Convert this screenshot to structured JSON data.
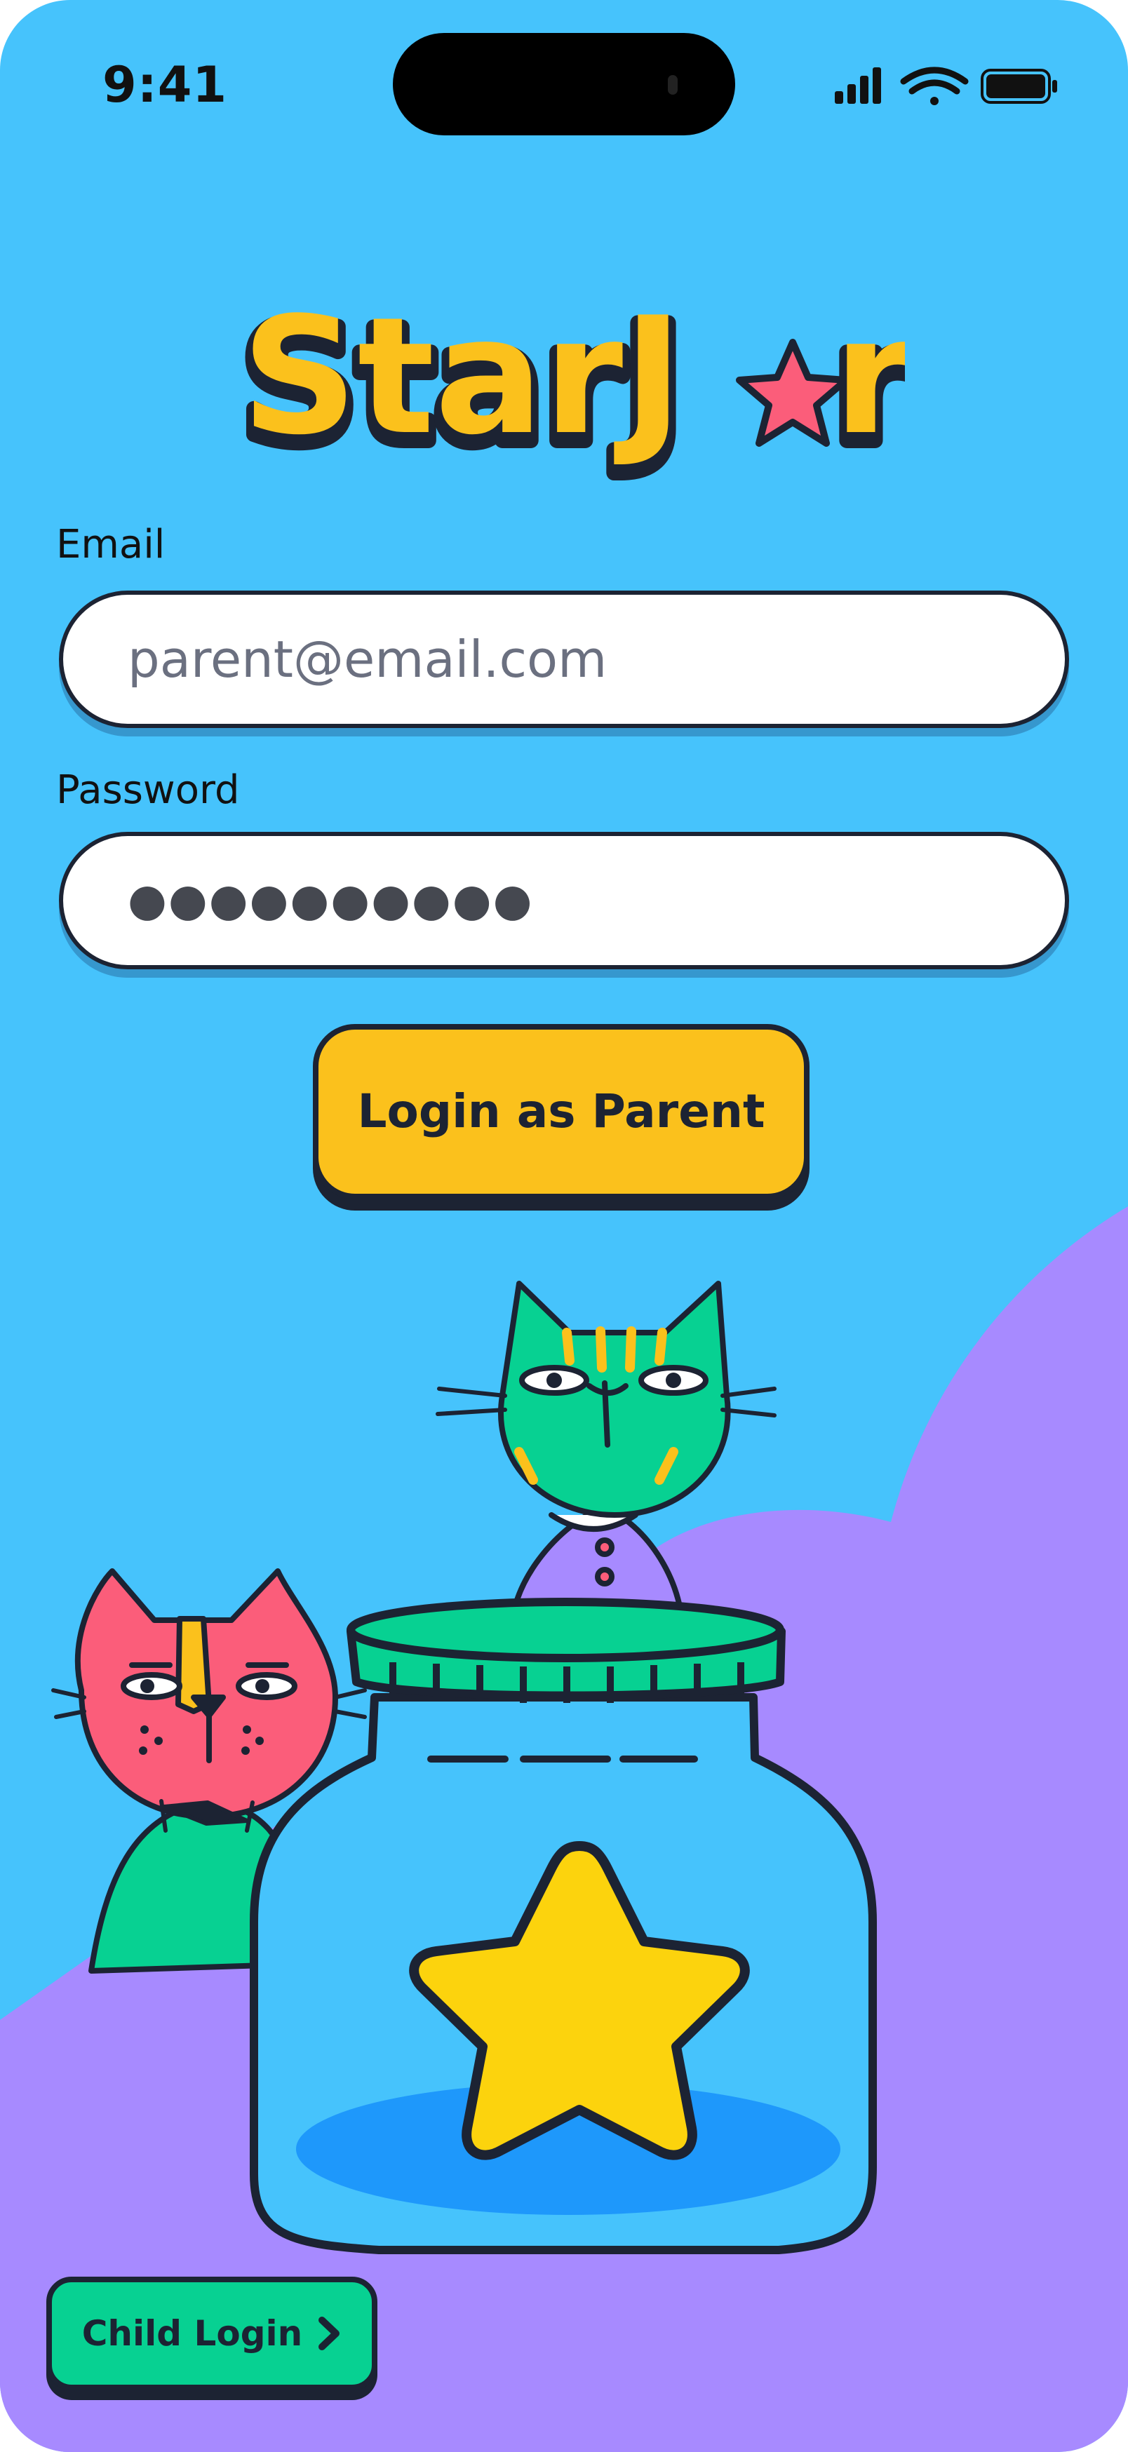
{
  "status_bar": {
    "time": "9:41",
    "signal_icon": "cellular-signal-icon",
    "wifi_icon": "wifi-icon",
    "battery_icon": "battery-icon"
  },
  "logo": {
    "text": "StarJ",
    "text_end": "r",
    "star_icon": "star-icon"
  },
  "form": {
    "email_label": "Email",
    "email_placeholder": "parent@email.com",
    "password_label": "Password",
    "password_value": "●●●●●●●●●●",
    "login_button": "Login as Parent"
  },
  "illustration": {
    "description_icons": [
      "cat-icon",
      "jar-icon",
      "star-icon"
    ]
  },
  "child_login": {
    "label": "Child Login",
    "icon": "chevron-right-icon"
  },
  "colors": {
    "background": "#46c3fc",
    "purple": "#a78aff",
    "yellow": "#fbc11c",
    "green": "#07d192",
    "pink": "#fb5d7a",
    "outline": "#1c2333"
  }
}
